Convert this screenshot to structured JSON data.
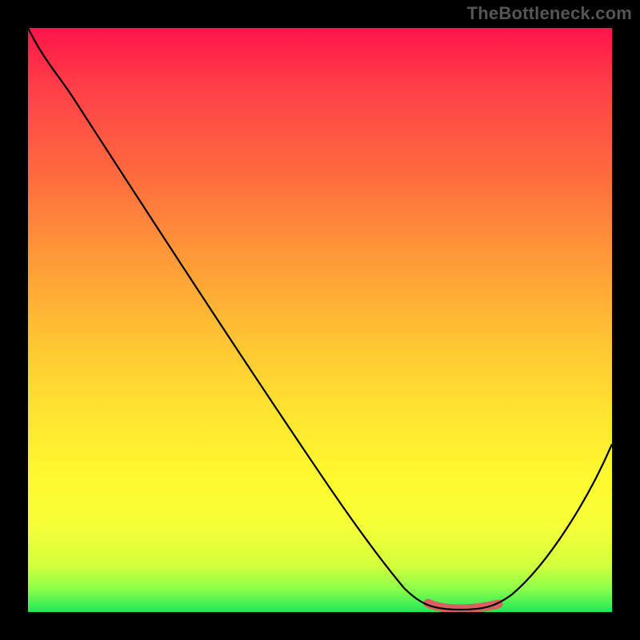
{
  "watermark": "TheBottleneck.com",
  "chart_data": {
    "type": "line",
    "title": "",
    "xlabel": "",
    "ylabel": "",
    "xlim": [
      0,
      100
    ],
    "ylim": [
      0,
      100
    ],
    "background": "red-yellow-green vertical gradient",
    "series": [
      {
        "name": "bottleneck-curve",
        "x": [
          0,
          6,
          14,
          22,
          30,
          38,
          46,
          54,
          60,
          64,
          68,
          72,
          76,
          80,
          86,
          92,
          100
        ],
        "values": [
          100,
          95,
          85,
          75,
          64,
          53,
          42,
          31,
          22,
          15,
          8,
          3,
          1,
          1,
          5,
          14,
          30
        ]
      }
    ],
    "annotations": [
      {
        "name": "trough-highlight",
        "x_start": 70,
        "x_end": 82,
        "y": 1,
        "color": "#d86060"
      }
    ]
  }
}
